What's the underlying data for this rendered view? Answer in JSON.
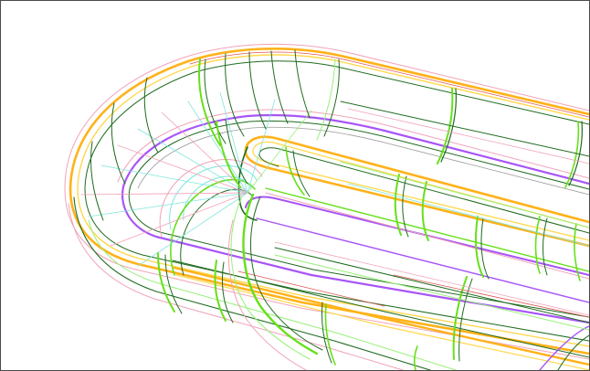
{
  "viewport": {
    "background": "#ffffff",
    "border_color": "#4a4a4a"
  },
  "model": {
    "subject": "wireframe-channel-model",
    "wire_colors": {
      "orange": "#ffb21a",
      "yellow": "#ffd84d",
      "lime": "#66e01a",
      "light_green": "#98f07a",
      "dark_green": "#1f6b1f",
      "violet": "#a855f7",
      "pink": "#f0a3b8",
      "cyan": "#7fe6dc",
      "red": "#e05555",
      "gray": "#9a9a9a"
    }
  }
}
